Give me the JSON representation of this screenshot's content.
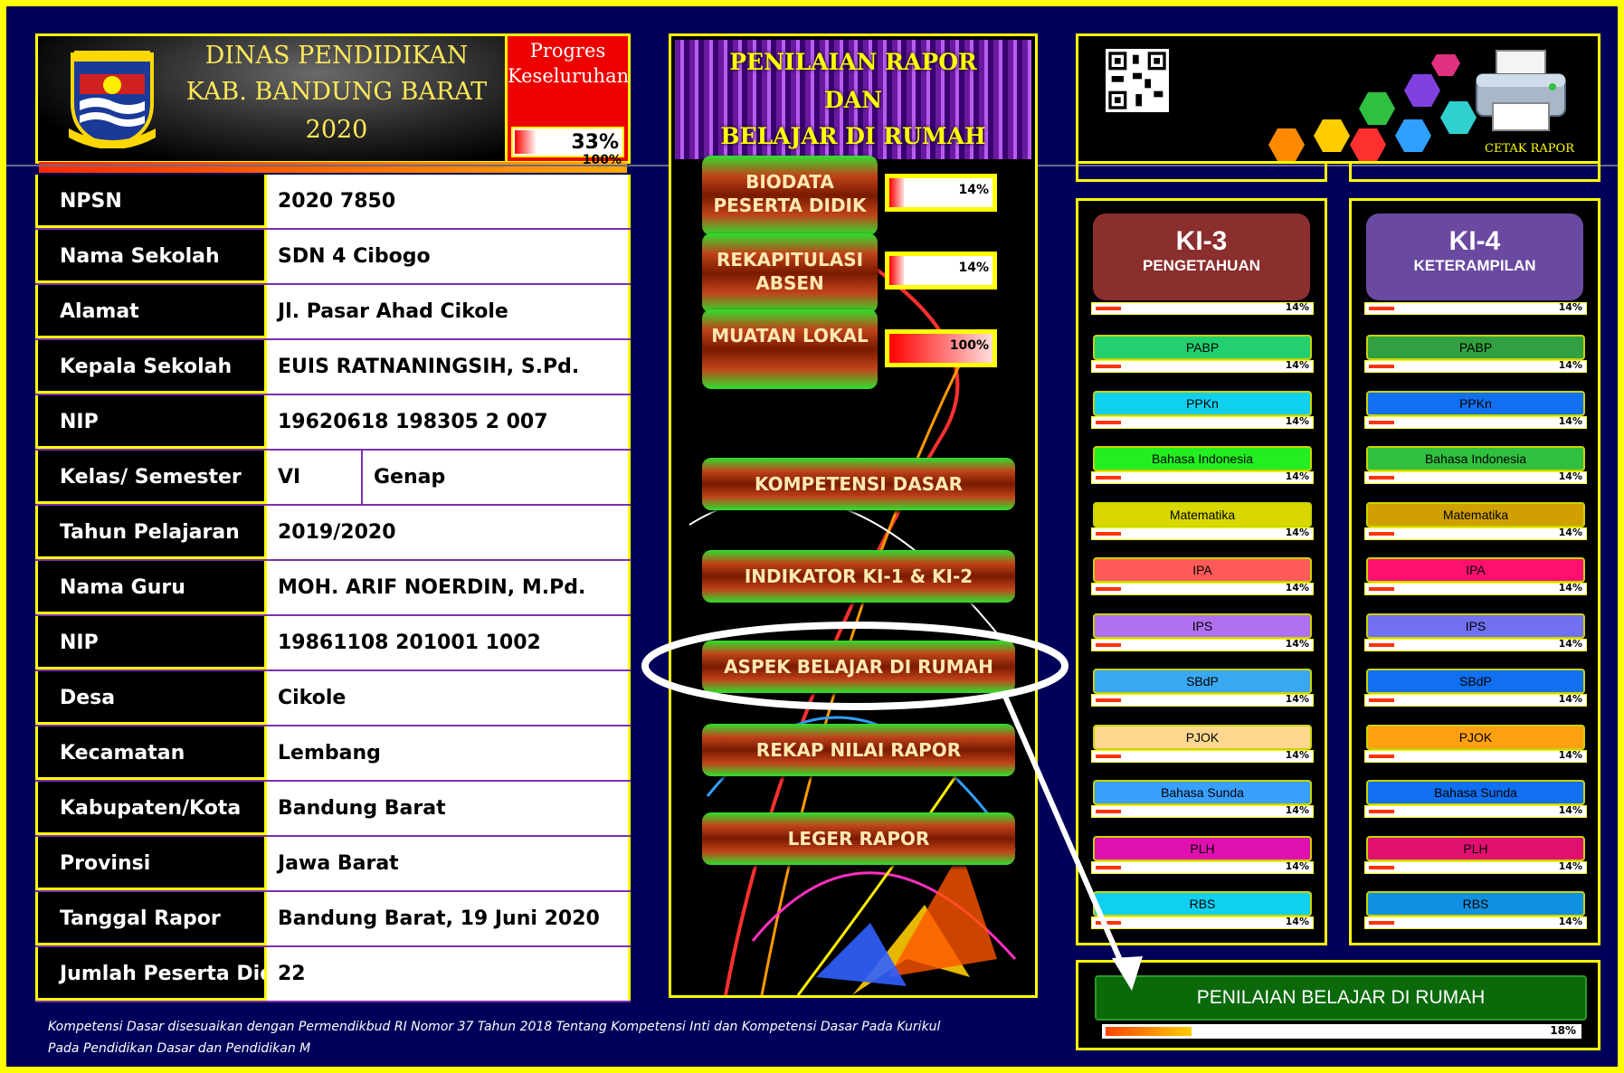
{
  "header": {
    "lines": [
      "DINAS PENDIDIKAN",
      "KAB. BANDUNG BARAT",
      "2020"
    ],
    "progress_label": "Progres Keseluruhan",
    "progress_value": "33%",
    "progress_fraction": 0.33,
    "full_bar_text": "100%"
  },
  "info": {
    "rows": [
      {
        "label": "NPSN",
        "value": "2020 7850"
      },
      {
        "label": "Nama Sekolah",
        "value": "SDN 4 Cibogo"
      },
      {
        "label": "Alamat",
        "value": "Jl. Pasar Ahad Cikole"
      },
      {
        "label": "Kepala Sekolah",
        "value": "EUIS RATNANINGSIH, S.Pd."
      },
      {
        "label": "NIP",
        "value": "19620618 198305 2 007"
      },
      {
        "label": "Kelas/ Semester",
        "value": "VI",
        "value2": "Genap"
      },
      {
        "label": "Tahun Pelajaran",
        "value": "2019/2020"
      },
      {
        "label": "Nama Guru",
        "value": "MOH. ARIF NOERDIN, M.Pd."
      },
      {
        "label": "NIP",
        "value": "19861108 201001 1002"
      },
      {
        "label": "Desa",
        "value": "Cikole"
      },
      {
        "label": "Kecamatan",
        "value": "Lembang"
      },
      {
        "label": "Kabupaten/Kota",
        "value": "Bandung Barat"
      },
      {
        "label": "Provinsi",
        "value": "Jawa Barat"
      },
      {
        "label": "Tanggal Rapor",
        "value": "Bandung Barat, 19 Juni 2020"
      },
      {
        "label": "Jumlah Peserta Did",
        "value": "22"
      }
    ]
  },
  "middle": {
    "title_lines": [
      "PENILAIAN RAPOR",
      "DAN",
      "BELAJAR DI RUMAH"
    ],
    "small_buttons": [
      {
        "label": "BIODATA PESERTA DIDIK",
        "progress": "14%",
        "fraction": 0.14
      },
      {
        "label": "REKAPITULASI ABSEN",
        "progress": "14%",
        "fraction": 0.14
      },
      {
        "label": "MUATAN LOKAL",
        "progress": "100%",
        "fraction": 1.0
      }
    ],
    "buttons": [
      "KOMPETENSI DASAR",
      "INDIKATOR KI-1 & KI-2",
      "ASPEK BELAJAR DI RUMAH",
      "REKAP NILAI RAPOR",
      "LEGER RAPOR"
    ]
  },
  "right_top": {
    "print_label": "CETAK RAPOR",
    "qr_icon": "qr-code-icon",
    "printer_icon": "printer-icon"
  },
  "ki3": {
    "title": "KI-3",
    "subtitle": "PENGETAHUAN",
    "color": "#8b2e2e",
    "header_progress": "14%",
    "subjects": [
      {
        "name": "PABP",
        "color": "#22d070",
        "progress": "14%"
      },
      {
        "name": "PPKn",
        "color": "#10d0f0",
        "progress": "14%"
      },
      {
        "name": "Bahasa Indonesia",
        "color": "#22ee22",
        "progress": "14%"
      },
      {
        "name": "Matematika",
        "color": "#d8d800",
        "progress": "14%"
      },
      {
        "name": "IPA",
        "color": "#ff5a5a",
        "progress": "14%"
      },
      {
        "name": "IPS",
        "color": "#b070f0",
        "progress": "14%"
      },
      {
        "name": "SBdP",
        "color": "#3aa8f0",
        "progress": "14%"
      },
      {
        "name": "PJOK",
        "color": "#ffd890",
        "progress": "14%"
      },
      {
        "name": "Bahasa Sunda",
        "color": "#3aa0ff",
        "progress": "14%"
      },
      {
        "name": "PLH",
        "color": "#e010b0",
        "progress": "14%"
      },
      {
        "name": "RBS",
        "color": "#10d0f0",
        "progress": "14%"
      }
    ]
  },
  "ki4": {
    "title": "KI-4",
    "subtitle": "KETERAMPILAN",
    "color": "#6a4aa0",
    "header_progress": "14%",
    "subjects": [
      {
        "name": "PABP",
        "color": "#30a040",
        "progress": "14%"
      },
      {
        "name": "PPKn",
        "color": "#1070f0",
        "progress": "14%"
      },
      {
        "name": "Bahasa Indonesia",
        "color": "#30c040",
        "progress": "14%"
      },
      {
        "name": "Matematika",
        "color": "#d0a000",
        "progress": "14%"
      },
      {
        "name": "IPA",
        "color": "#ff1070",
        "progress": "14%"
      },
      {
        "name": "IPS",
        "color": "#7070f0",
        "progress": "14%"
      },
      {
        "name": "SBdP",
        "color": "#1070f0",
        "progress": "14%"
      },
      {
        "name": "PJOK",
        "color": "#ffa010",
        "progress": "14%"
      },
      {
        "name": "Bahasa Sunda",
        "color": "#1070f0",
        "progress": "14%"
      },
      {
        "name": "PLH",
        "color": "#e01070",
        "progress": "14%"
      },
      {
        "name": "RBS",
        "color": "#1090e0",
        "progress": "14%"
      }
    ]
  },
  "bottom": {
    "button_label": "PENILAIAN  BELAJAR  DI RUMAH",
    "progress": "18%",
    "fraction": 0.18
  },
  "footnote": {
    "line1": "Kompetensi Dasar disesuaikan dengan Permendikbud RI Nomor 37 Tahun 2018 Tentang Kompetensi Inti dan Kompetensi Dasar Pada Kurikul",
    "line2": "Pada Pendidikan Dasar dan Pendidikan M"
  }
}
